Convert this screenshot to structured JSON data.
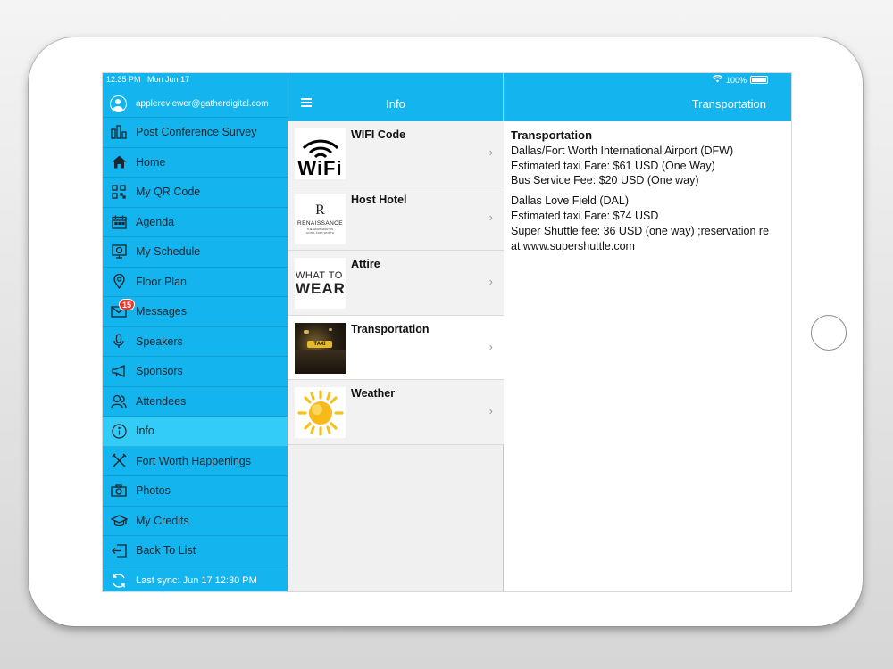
{
  "status_bar": {
    "time": "12:35 PM",
    "date": "Mon Jun 17",
    "battery": "100%"
  },
  "user": {
    "email": "applereviewer@gatherdigital.com"
  },
  "menu": [
    {
      "label": "Post Conference Survey",
      "icon": "bar-chart-icon"
    },
    {
      "label": "Home",
      "icon": "home-icon"
    },
    {
      "label": "My QR Code",
      "icon": "qr-code-icon"
    },
    {
      "label": "Agenda",
      "icon": "calendar-icon"
    },
    {
      "label": "My Schedule",
      "icon": "schedule-icon"
    },
    {
      "label": "Floor Plan",
      "icon": "map-pin-icon"
    },
    {
      "label": "Messages",
      "icon": "envelope-icon",
      "badge": "15"
    },
    {
      "label": "Speakers",
      "icon": "microphone-icon"
    },
    {
      "label": "Sponsors",
      "icon": "megaphone-icon"
    },
    {
      "label": "Attendees",
      "icon": "people-icon"
    },
    {
      "label": "Info",
      "icon": "info-icon",
      "active": true
    },
    {
      "label": "Fort Worth Happenings",
      "icon": "utensils-icon"
    },
    {
      "label": "Photos",
      "icon": "camera-icon"
    },
    {
      "label": "My Credits",
      "icon": "graduation-cap-icon"
    },
    {
      "label": "Back To List",
      "icon": "back-arrow-icon"
    }
  ],
  "sync": {
    "label": "Last sync:  Jun 17 12:30 PM"
  },
  "middle": {
    "title": "Info",
    "items": [
      {
        "label": "WIFI Code",
        "thumb_text": "WiFi"
      },
      {
        "label": "Host Hotel",
        "thumb_text": "RENAISSANCE",
        "thumb_sub": "THE WORTHINGTON HOTEL FORT WORTH"
      },
      {
        "label": "Attire",
        "thumb_text_1": "WHAT TO",
        "thumb_text_2": "WEAR"
      },
      {
        "label": "Transportation",
        "thumb_text": "TAXI",
        "selected": true
      },
      {
        "label": "Weather"
      }
    ]
  },
  "detail": {
    "title": "Transportation",
    "heading": "Transportation",
    "lines_1": [
      "Dallas/Fort Worth International Airport (DFW)",
      "Estimated taxi Fare: $61 USD (One Way)",
      "Bus Service Fee: $20 USD (One way)"
    ],
    "lines_2": [
      "Dallas Love Field (DAL)",
      "Estimated taxi Fare: $74 USD",
      "Super Shuttle fee: 36 USD (one way) ;reservation re",
      "at www.supershuttle.com"
    ]
  },
  "colors": {
    "accent": "#14b4ee",
    "active": "#33cbf7",
    "badge": "#e83a2f"
  }
}
